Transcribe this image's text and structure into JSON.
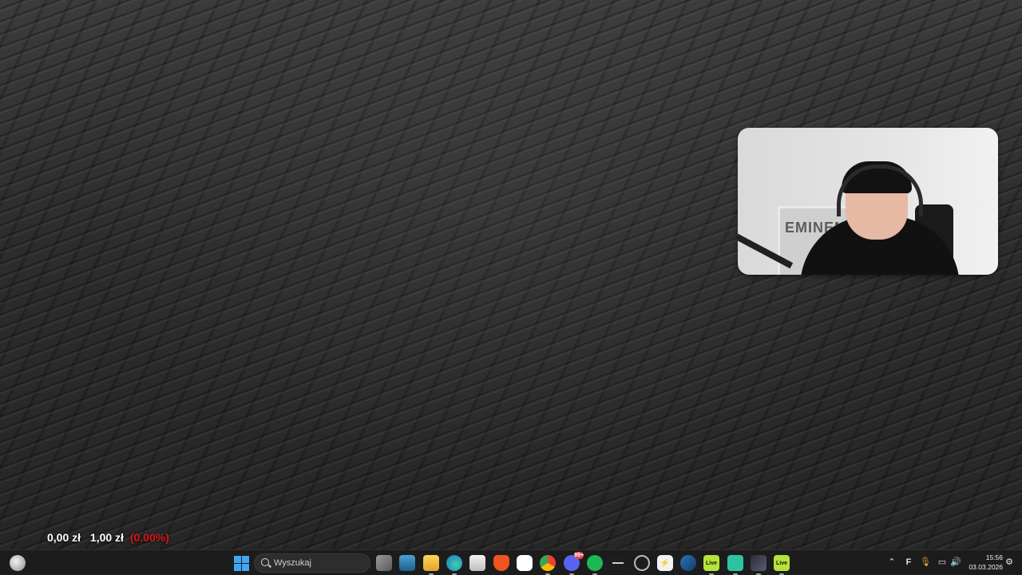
{
  "ticker": {
    "price_a": "0,00 zł",
    "price_b": "1,00 zł",
    "change": "(0.00%)",
    "change_color": "#d81818"
  },
  "webcam": {
    "poster_text": "EMINEM"
  },
  "taskbar": {
    "search_label": "Wyszukaj",
    "apps": [
      {
        "name": "task-view",
        "icon": "task-view-icon"
      },
      {
        "name": "widgets-board",
        "icon": "monitor-icon"
      },
      {
        "name": "file-explorer",
        "icon": "folder-icon"
      },
      {
        "name": "edge",
        "icon": "edge-icon"
      },
      {
        "name": "microsoft-store",
        "icon": "store-icon"
      },
      {
        "name": "brave",
        "icon": "brave-icon"
      },
      {
        "name": "onedrive-cloud",
        "icon": "cloud-icon"
      },
      {
        "name": "chrome",
        "icon": "chrome-icon"
      },
      {
        "name": "discord",
        "icon": "discord-icon",
        "badge": "99+"
      },
      {
        "name": "spotify",
        "icon": "spotify-icon"
      },
      {
        "name": "lanayou",
        "icon": "waveform-icon"
      },
      {
        "name": "audio-mixer",
        "icon": "mixer-icon"
      },
      {
        "name": "streamlabs",
        "icon": "bolt-icon"
      },
      {
        "name": "steam",
        "icon": "steam-icon"
      },
      {
        "name": "live-app-1",
        "icon": "live-icon",
        "label": "Live"
      },
      {
        "name": "obs-like",
        "icon": "camera-icon"
      },
      {
        "name": "davinci",
        "icon": "davinci-icon"
      },
      {
        "name": "live-app-2",
        "icon": "live-icon",
        "label": "Live"
      }
    ],
    "clock_time": "15:56",
    "clock_date": "03.03.2026"
  },
  "colors": {
    "start_blue": "#3fa8f4",
    "live_green": "#b6e23a",
    "spotify_green": "#1db954",
    "discord_purple": "#5865f2",
    "brave_orange": "#f0541e"
  }
}
